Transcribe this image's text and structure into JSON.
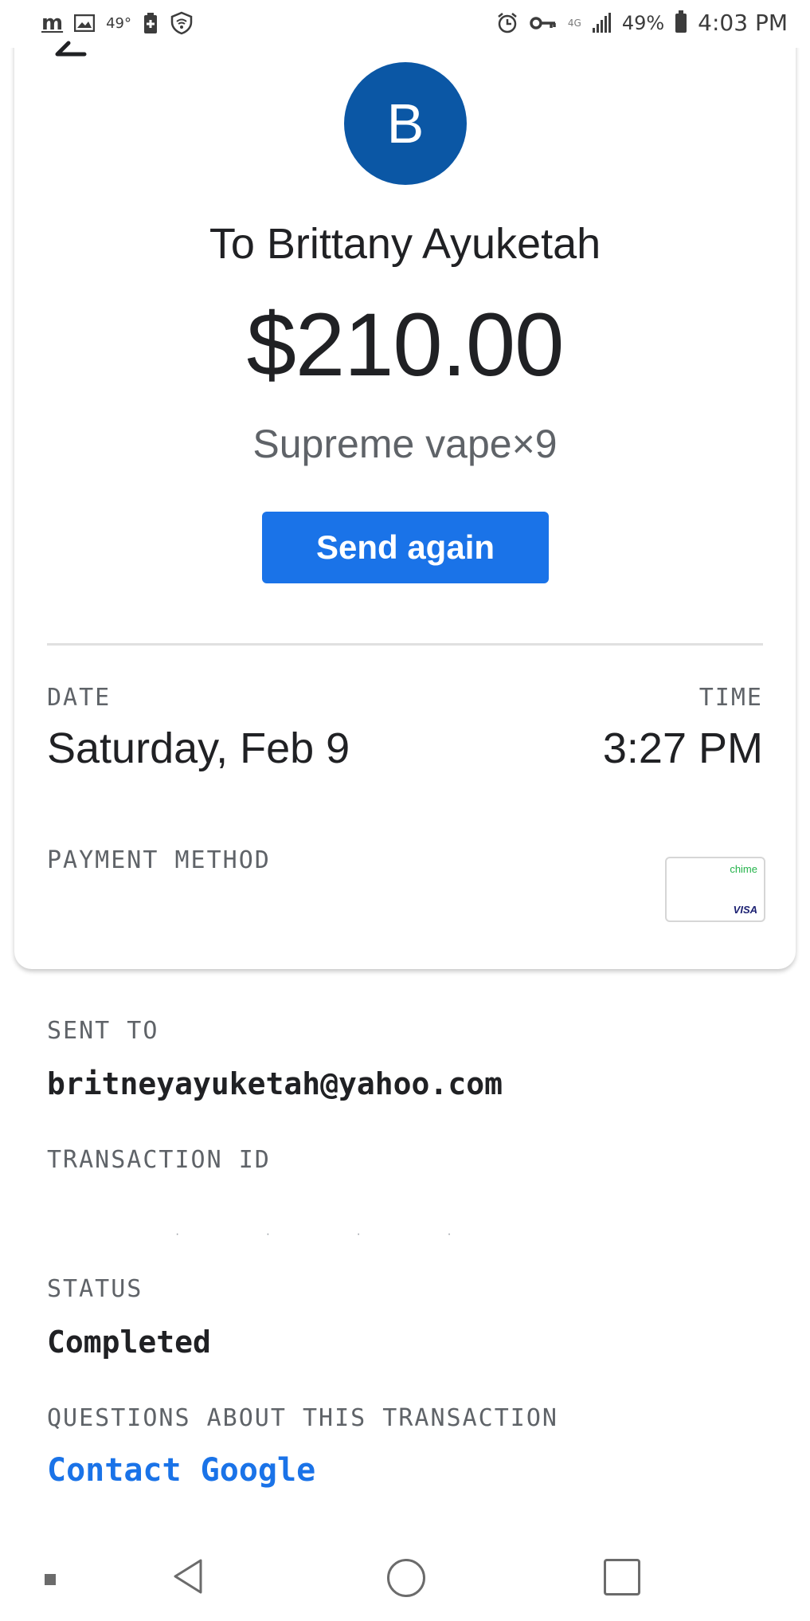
{
  "status_bar": {
    "app_indicator": "m",
    "temperature": "49°",
    "battery_percent": "49%",
    "time": "4:03 PM",
    "icons": [
      "app-m-icon",
      "image-icon",
      "battery-saver-icon",
      "shield-wifi-icon",
      "alarm-icon",
      "vpn-key-icon",
      "lte-icon",
      "signal-icon",
      "battery-icon"
    ]
  },
  "header": {
    "back_icon": "back-arrow-icon"
  },
  "recipient": {
    "avatar_letter": "B",
    "avatar_color": "#0b57a5",
    "to_label": "To Brittany Ayuketah"
  },
  "payment": {
    "amount": "$210.00",
    "memo": "Supreme vape×9",
    "send_again_label": "Send again",
    "accent_color": "#1a73e8"
  },
  "details": {
    "date_label": "Date",
    "date_value": "Saturday, Feb 9",
    "time_label": "Time",
    "time_value": "3:27 PM",
    "payment_method_label": "Payment method",
    "card_brand_top": "chime",
    "card_brand_bottom": "VISA"
  },
  "extra": {
    "sent_to_label": "Sent to",
    "sent_to_value": "britneyayuketah@yahoo.com",
    "transaction_id_label": "Transaction ID",
    "status_label": "Status",
    "status_value": "Completed",
    "questions_label": "Questions about this transaction",
    "contact_link": "Contact Google"
  },
  "navbar": {
    "icons": [
      "nav-indicator-icon",
      "back-triangle-icon",
      "home-circle-icon",
      "recents-square-icon"
    ]
  }
}
